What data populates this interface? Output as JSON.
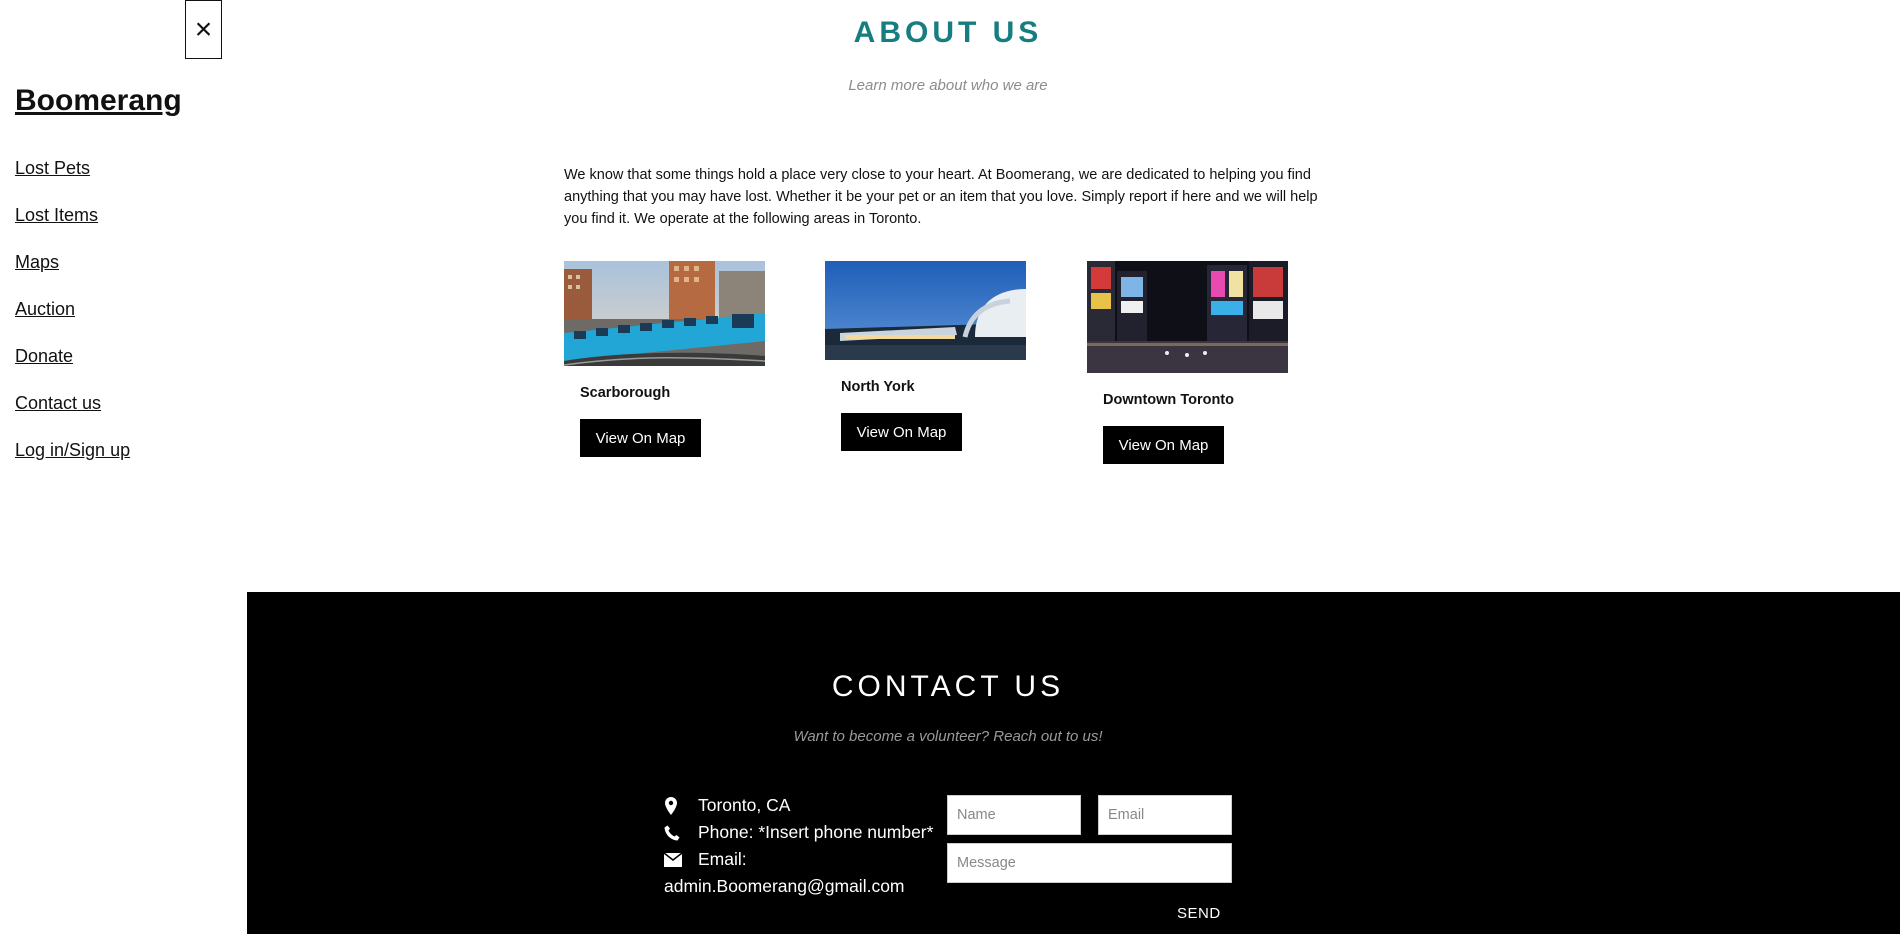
{
  "sidebar": {
    "close_label": "×",
    "brand": "Boomerang",
    "items": [
      {
        "label": "Lost Pets"
      },
      {
        "label": "Lost Items"
      },
      {
        "label": "Maps"
      },
      {
        "label": "Auction"
      },
      {
        "label": "Donate"
      },
      {
        "label": "Contact us"
      },
      {
        "label": "Log in/Sign up"
      }
    ]
  },
  "about": {
    "title": "ABOUT US",
    "subtitle": "Learn more about who we are",
    "body": "We know that some things hold a place very close to your heart. At Boomerang, we are dedicated to helping you find anything that you may have lost. Whether it be your pet or an item that you love. Simply report if here and we will help you find it. We operate at the following areas in Toronto.",
    "locations": [
      {
        "name": "Scarborough",
        "button": "View On Map"
      },
      {
        "name": "North York",
        "button": "View On Map"
      },
      {
        "name": "Downtown Toronto",
        "button": "View On Map"
      }
    ]
  },
  "contact": {
    "title": "CONTACT US",
    "subtitle": "Want to become a volunteer? Reach out to us!",
    "location": "Toronto, CA",
    "phone": "Phone: *Insert phone number*",
    "email_label": "Email:",
    "email_value": "admin.Boomerang@gmail.com",
    "name_placeholder": "Name",
    "email_placeholder": "Email",
    "message_placeholder": "Message",
    "send_label": "SEND"
  },
  "colors": {
    "accent": "#167d80",
    "footer_bg": "#000000",
    "button_bg": "#000000"
  },
  "icons": {
    "location": "map-marker-icon",
    "phone": "phone-icon",
    "email": "envelope-icon",
    "close": "close-icon"
  }
}
